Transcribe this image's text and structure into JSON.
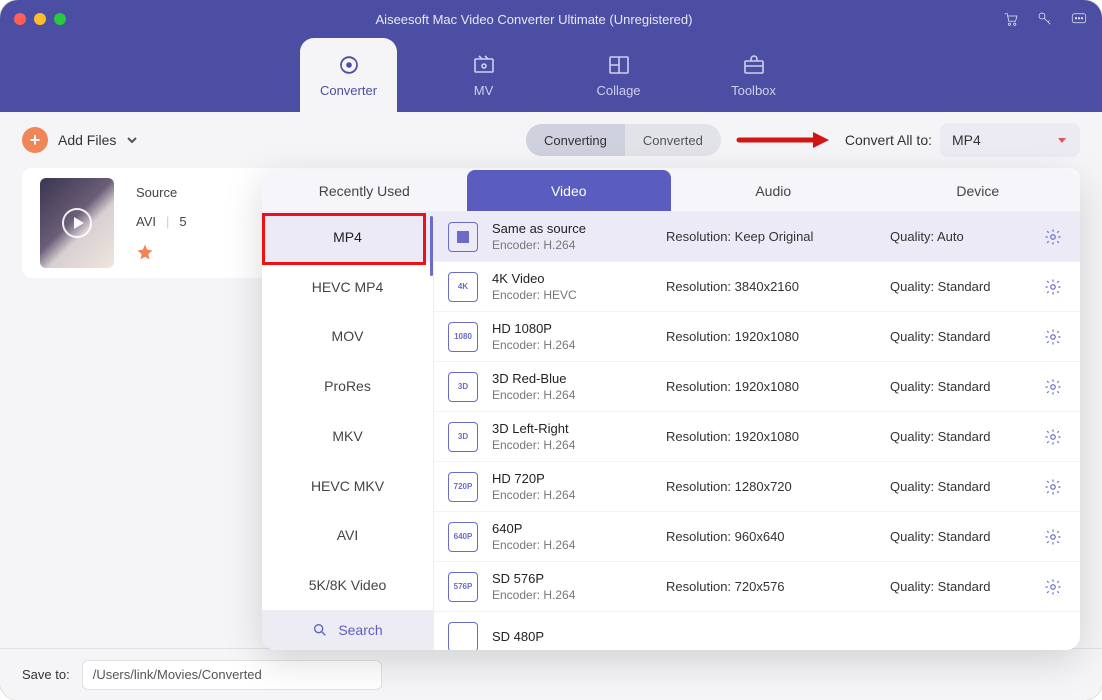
{
  "window": {
    "title": "Aiseesoft Mac Video Converter Ultimate (Unregistered)"
  },
  "main_tabs": {
    "converter": "Converter",
    "mv": "MV",
    "collage": "Collage",
    "toolbox": "Toolbox"
  },
  "toolbar": {
    "add_files": "Add Files",
    "seg_converting": "Converting",
    "seg_converted": "Converted",
    "convert_all_label": "Convert All to:",
    "convert_all_value": "MP4"
  },
  "file": {
    "source_label": "Source",
    "format": "AVI",
    "size_prefix": "5"
  },
  "footer": {
    "save_to_label": "Save to:",
    "path": "/Users/link/Movies/Converted"
  },
  "popup": {
    "tabs": {
      "recent": "Recently Used",
      "video": "Video",
      "audio": "Audio",
      "device": "Device"
    },
    "search": "Search",
    "formats": [
      "MP4",
      "HEVC MP4",
      "MOV",
      "ProRes",
      "MKV",
      "HEVC MKV",
      "AVI",
      "5K/8K Video"
    ],
    "col_resolution_label": "Resolution: ",
    "col_quality_label": "Quality: ",
    "encoder_label": "Encoder: ",
    "presets": [
      {
        "title": "Same as source",
        "encoder": "H.264",
        "resolution": "Keep Original",
        "quality": "Auto"
      },
      {
        "title": "4K Video",
        "encoder": "HEVC",
        "resolution": "3840x2160",
        "quality": "Standard"
      },
      {
        "title": "HD 1080P",
        "encoder": "H.264",
        "resolution": "1920x1080",
        "quality": "Standard"
      },
      {
        "title": "3D Red-Blue",
        "encoder": "H.264",
        "resolution": "1920x1080",
        "quality": "Standard"
      },
      {
        "title": "3D Left-Right",
        "encoder": "H.264",
        "resolution": "1920x1080",
        "quality": "Standard"
      },
      {
        "title": "HD 720P",
        "encoder": "H.264",
        "resolution": "1280x720",
        "quality": "Standard"
      },
      {
        "title": "640P",
        "encoder": "H.264",
        "resolution": "960x640",
        "quality": "Standard"
      },
      {
        "title": "SD 576P",
        "encoder": "H.264",
        "resolution": "720x576",
        "quality": "Standard"
      },
      {
        "title": "SD 480P",
        "encoder": "",
        "resolution": "",
        "quality": ""
      }
    ]
  }
}
